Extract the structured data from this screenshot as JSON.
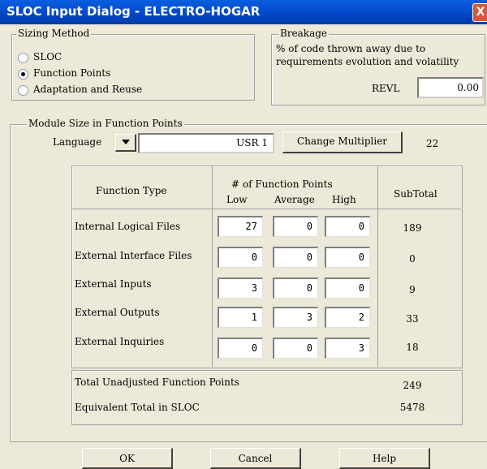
{
  "window": {
    "title": "SLOC Input Dialog - ELECTRO-HOGAR",
    "close_glyph": "X"
  },
  "sizing_method": {
    "legend": "Sizing Method",
    "options": [
      "SLOC",
      "Function Points",
      "Adaptation and Reuse"
    ],
    "selected": "Function Points"
  },
  "breakage": {
    "legend": "Breakage",
    "desc_line1": "% of code thrown away due to",
    "desc_line2": "requirements evolution and volatility",
    "revl_label": "REVL",
    "revl_value": "0.00"
  },
  "module_size": {
    "legend": "Module Size in Function Points",
    "language_label": "Language",
    "language_value": "USR 1",
    "change_multiplier_label": "Change Multiplier",
    "multiplier": "22"
  },
  "fp_table": {
    "col_function_type": "Function Type",
    "col_fp_header": "# of Function Points",
    "col_low": "Low",
    "col_average": "Average",
    "col_high": "High",
    "col_subtotal": "SubTotal",
    "rows": [
      {
        "label": "Internal Logical Files",
        "low": "27",
        "average": "0",
        "high": "0",
        "subtotal": "189"
      },
      {
        "label": "External Interface Files",
        "low": "0",
        "average": "0",
        "high": "0",
        "subtotal": "0"
      },
      {
        "label": "External Inputs",
        "low": "3",
        "average": "0",
        "high": "0",
        "subtotal": "9"
      },
      {
        "label": "External Outputs",
        "low": "1",
        "average": "3",
        "high": "2",
        "subtotal": "33"
      },
      {
        "label": "External Inquiries",
        "low": "0",
        "average": "0",
        "high": "3",
        "subtotal": "18"
      }
    ]
  },
  "totals": {
    "unadjusted_label": "Total Unadjusted Function Points",
    "unadjusted_value": "249",
    "sloc_label": "Equivalent Total in SLOC",
    "sloc_value": "5478"
  },
  "buttons": {
    "ok": "OK",
    "cancel": "Cancel",
    "help": "Help"
  },
  "icons": {
    "dropdown": "chevron-down-icon"
  }
}
